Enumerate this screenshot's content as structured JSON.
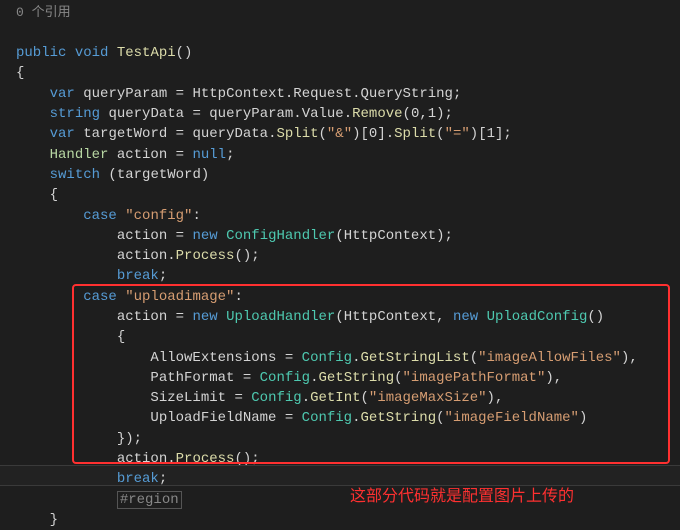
{
  "codelens": "0 个引用",
  "line1": {
    "public": "public",
    "void": "void",
    "name": "TestApi"
  },
  "line3": {
    "var": "var",
    "queryParam": "queryParam",
    "eq": " = ",
    "HttpContext": "HttpContext",
    "dot1": ".",
    "Request": "Request",
    "dot2": ".",
    "QueryString": "QueryString",
    "end": ";"
  },
  "line4": {
    "string": "string",
    "queryData": "queryData",
    "eq": " = ",
    "prop1": "queryParam.",
    "Value": "Value",
    "dot": ".",
    "Remove": "Remove",
    "args": "(0,1);"
  },
  "line5": {
    "var": "var",
    "targetWord": "targetWord",
    "eq": " = ",
    "prop": "queryData.",
    "Split1": "Split",
    "arg1a": "(",
    "str1": "\"&\"",
    "arg1b": ")",
    "idx1": "[0].",
    "Split2": "Split",
    "arg2a": "(",
    "str2": "\"=\"",
    "arg2b": ")",
    "idx2": "[1];"
  },
  "line6": {
    "Handler": "Handler",
    "action": "action",
    "eq": " = ",
    "null": "null",
    "end": ";"
  },
  "line7": {
    "switch": "switch",
    "targetWord": " (targetWord)"
  },
  "case1": {
    "case": "case",
    "str": "\"config\"",
    "colon": ":"
  },
  "case1a": {
    "action": "action",
    "eq": " = ",
    "new": "new",
    "Config": "ConfigHandler",
    "args": "(HttpContext);"
  },
  "case1b": {
    "action": "action.",
    "Process": "Process",
    "args": "();"
  },
  "case1c": {
    "break": "break",
    "end": ";"
  },
  "case2": {
    "case": "case",
    "str": "\"uploadimage\"",
    "colon": ":"
  },
  "case2a": {
    "action": "action",
    "eq": " = ",
    "new1": "new",
    "Upload": "UploadHandler",
    "args1": "(HttpContext, ",
    "new2": "new",
    "UploadConfig": "UploadConfig",
    "args2": "()"
  },
  "case2b": {
    "prop": "AllowExtensions",
    "eq": " = ",
    "Config": "Config",
    "dot": ".",
    "Get": "GetStringList",
    "p1": "(",
    "str": "\"imageAllowFiles\"",
    "p2": "),"
  },
  "case2c": {
    "prop": "PathFormat",
    "eq": " = ",
    "Config": "Config",
    "dot": ".",
    "Get": "GetString",
    "p1": "(",
    "str": "\"imagePathFormat\"",
    "p2": "),"
  },
  "case2d": {
    "prop": "SizeLimit",
    "eq": " = ",
    "Config": "Config",
    "dot": ".",
    "Get": "GetInt",
    "p1": "(",
    "str": "\"imageMaxSize\"",
    "p2": "),"
  },
  "case2e": {
    "prop": "UploadFieldName",
    "eq": " = ",
    "Config": "Config",
    "dot": ".",
    "Get": "GetString",
    "p1": "(",
    "str": "\"imageFieldName\"",
    "p2": ")"
  },
  "case2f": {
    "close": "});"
  },
  "case2g": {
    "action": "action.",
    "Process": "Process",
    "args": "();"
  },
  "case2h": {
    "break": "break",
    "end": ";"
  },
  "region": "#region",
  "annotation": "这部分代码就是配置图片上传的"
}
